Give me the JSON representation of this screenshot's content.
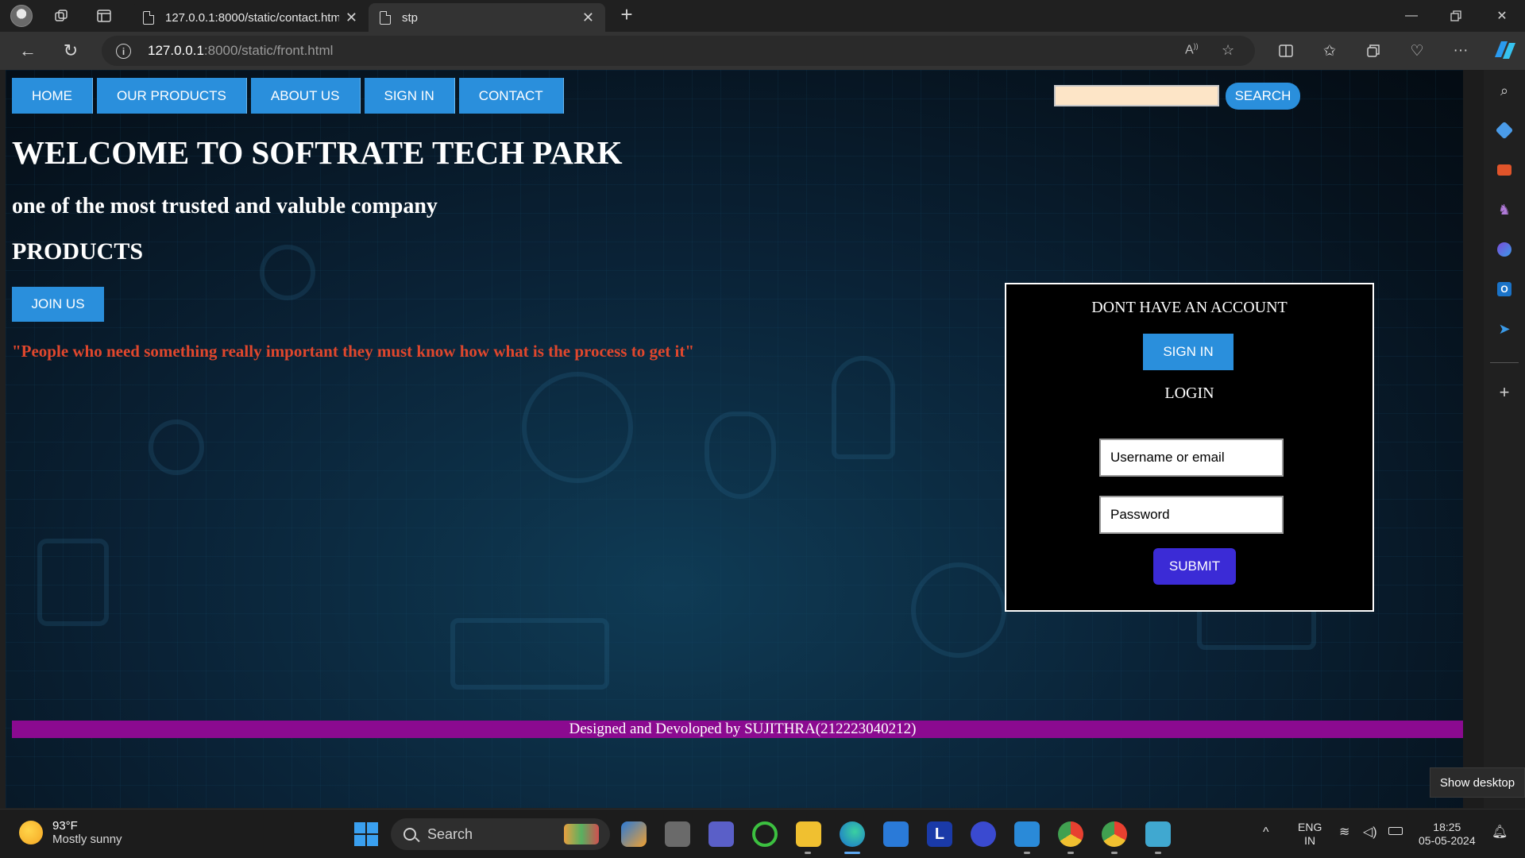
{
  "browser": {
    "tabs": [
      {
        "title": "127.0.0.1:8000/static/contact.html",
        "active": false
      },
      {
        "title": "stp",
        "active": true
      }
    ],
    "url_host": "127.0.0.1",
    "url_rest": ":8000/static/front.html"
  },
  "nav": {
    "items": [
      "HOME",
      "OUR PRODUCTS",
      "ABOUT US",
      "SIGN IN",
      "CONTACT"
    ],
    "search_button": "SEARCH",
    "search_value": ""
  },
  "hero": {
    "welcome": "WELCOME TO SOFTRATE TECH PARK",
    "tagline": "one of the most trusted and valuble company",
    "products": "PRODUCTS",
    "join_button": "JOIN US",
    "quote": "\"People who need something really important they must know how what is the process to get it\""
  },
  "login_box": {
    "signup_heading": "DONT HAVE AN ACCOUNT",
    "signin_button": "SIGN IN",
    "login_heading": "LOGIN",
    "username_placeholder": "Username or email",
    "password_placeholder": "Password",
    "submit_button": "SUBMIT"
  },
  "footer": {
    "text": "Designed and Devoloped by SUJITHRA(212223040212)"
  },
  "overlay": {
    "show_desktop": "Show desktop"
  },
  "taskbar": {
    "weather_temp": "93°F",
    "weather_desc": "Mostly sunny",
    "search_label": "Search",
    "lang_1": "ENG",
    "lang_2": "IN",
    "time": "18:25",
    "date": "05-05-2024"
  },
  "colors": {
    "nav_blue": "#2a8fdc",
    "footer_purple": "#8b0a90",
    "quote_red": "#e0472d",
    "submit_indigo": "#3b2bd6",
    "search_input_bg": "#fde5c7"
  }
}
